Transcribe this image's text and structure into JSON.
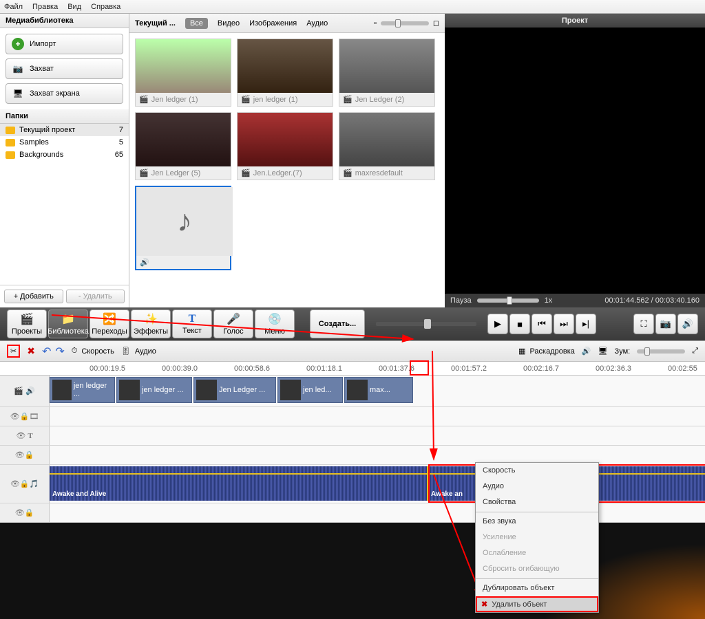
{
  "menu": {
    "file": "Файл",
    "edit": "Правка",
    "view": "Вид",
    "help": "Справка"
  },
  "library": {
    "title": "Медиабиблиотека",
    "import": "Импорт",
    "capture": "Захват",
    "screencap": "Захват экрана",
    "foldersTitle": "Папки",
    "folders": [
      {
        "name": "Текущий проект",
        "count": "7"
      },
      {
        "name": "Samples",
        "count": "5"
      },
      {
        "name": "Backgrounds",
        "count": "65"
      }
    ],
    "add": "+ Добавить",
    "del": "-  Удалить"
  },
  "filter": {
    "current": "Текущий ...",
    "all": "Все",
    "video": "Видео",
    "images": "Изображения",
    "audio": "Аудио"
  },
  "thumbs": [
    {
      "label": "Jen ledger (1)"
    },
    {
      "label": "jen ledger (1)"
    },
    {
      "label": "Jen Ledger (2)"
    },
    {
      "label": "Jen Ledger (5)"
    },
    {
      "label": "Jen.Ledger.(7)"
    },
    {
      "label": "maxresdefault"
    }
  ],
  "preview": {
    "title": "Проект",
    "pause": "Пауза",
    "speed": "1x",
    "time": "00:01:44.562 / 00:03:40.160"
  },
  "toolbar": {
    "projects": "Проекты",
    "library": "Библиотека",
    "transitions": "Переходы",
    "effects": "Эффекты",
    "text": "Текст",
    "voice": "Голос",
    "menu": "Меню",
    "create": "Создать..."
  },
  "tltools": {
    "speed": "Скорость",
    "audio": "Аудио",
    "storyboard": "Раскадровка",
    "zoom": "Зум:"
  },
  "ruler": [
    "00:00:19.5",
    "00:00:39.0",
    "00:00:58.6",
    "00:01:18.1",
    "00:01:37.6",
    "00:01:57.2",
    "00:02:16.7",
    "00:02:36.3",
    "00:02:55"
  ],
  "clips": [
    {
      "label": "jen ledger ..."
    },
    {
      "label": "jen ledger ..."
    },
    {
      "label": "Jen Ledger ..."
    },
    {
      "label": "jen led..."
    },
    {
      "label": "max..."
    }
  ],
  "audio": {
    "label1": "Awake and Alive",
    "label2": "Awake an"
  },
  "ctx": {
    "speed": "Скорость",
    "audio": "Аудио",
    "props": "Свойства",
    "mute": "Без звука",
    "amp": "Усиление",
    "fade": "Ослабление",
    "reset": "Сбросить огибающую",
    "dup": "Дублировать объект",
    "del": "Удалить объект"
  }
}
